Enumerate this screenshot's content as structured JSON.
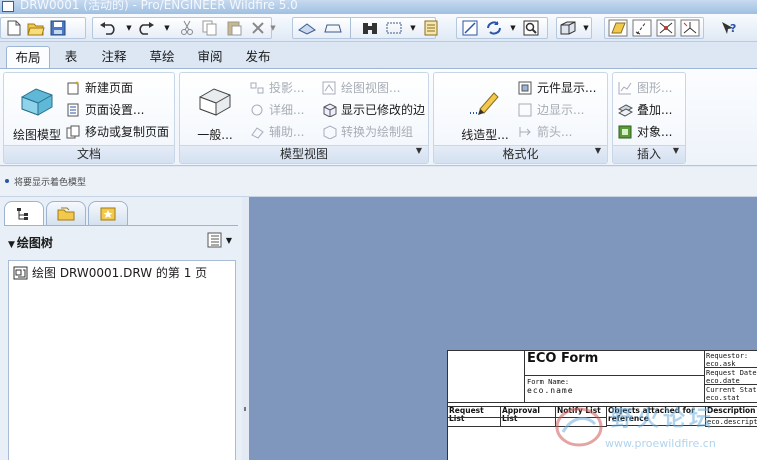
{
  "window": {
    "title": "DRW0001 (活动的) - Pro/ENGINEER Wildfire 5.0"
  },
  "quick_toolbar": {
    "icons": [
      "new-icon",
      "open-icon",
      "save-icon",
      "undo-icon",
      "redo-icon",
      "cut-icon",
      "copy-icon",
      "paste-icon",
      "delete-icon",
      "regenerate-icon",
      "repaint-icon",
      "find-icon",
      "select-box-icon",
      "layer-icon",
      "orient-icon",
      "refresh-icon",
      "zoom-icon",
      "display-style-icon",
      "datum-plane-icon",
      "datum-axis-icon",
      "datum-point-icon",
      "datum-csys-icon",
      "help-icon"
    ]
  },
  "ribbon": {
    "tabs": [
      {
        "label": "布局",
        "active": true
      },
      {
        "label": "表"
      },
      {
        "label": "注释"
      },
      {
        "label": "草绘"
      },
      {
        "label": "审阅"
      },
      {
        "label": "发布"
      }
    ],
    "groups": {
      "document": {
        "title": "文档",
        "big_button": "绘图模型",
        "items": [
          "新建页面",
          "页面设置...",
          "移动或复制页面"
        ]
      },
      "model_views": {
        "title": "模型视图",
        "big_button": "一般...",
        "col1": [
          "投影...",
          "详细...",
          "辅助..."
        ],
        "col2": [
          "绘图视图...",
          "显示已修改的边",
          "转换为绘制组"
        ]
      },
      "format": {
        "title": "格式化",
        "big_button": "线造型...",
        "items": [
          "元件显示...",
          "边显示...",
          "箭头..."
        ]
      },
      "insert": {
        "title": "插入",
        "items": [
          "图形...",
          "叠加...",
          "对象..."
        ]
      }
    }
  },
  "status_message": "将要显示着色模型",
  "navigator": {
    "tree_title": "绘图树",
    "tree_items": [
      "绘图 DRW0001.DRW 的第 1 页"
    ]
  },
  "drawing": {
    "form_title": "ECO Form",
    "form_name_label": "Form Name:",
    "form_name_value": "eco.name",
    "requestor_label": "Requestor:",
    "requestor_value": "eco.ask",
    "request_date_label": "Request Date:",
    "request_date_value": "eco.date",
    "current_status_label": "Current Status:",
    "current_status_value": "eco.stat",
    "columns": [
      "Request List",
      "Approval List",
      "Notify List",
      "Objects attached for reference",
      "Description"
    ],
    "description_value": "eco.description"
  },
  "watermark": {
    "site_name": "野火论坛",
    "site_url": "www.proewildfire.cn"
  },
  "colors": {
    "graphics_bg": "#7f97bd",
    "ribbon_bg": "#f1f6fc",
    "accent": "#2a55a8"
  }
}
